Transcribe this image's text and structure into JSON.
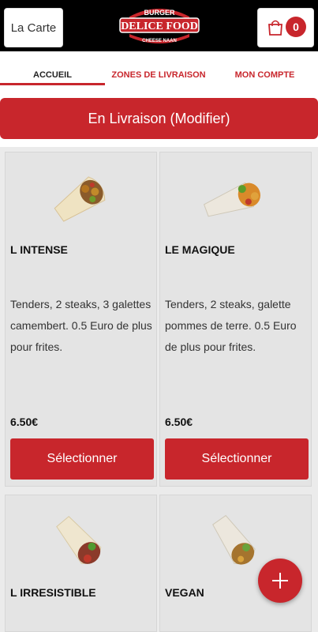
{
  "header": {
    "menu_label": "La Carte",
    "logo": {
      "top_text": "BURGER",
      "brand": "DELICE FOOD",
      "bottom_text": "CHEESE NAAN"
    },
    "cart_count": "0"
  },
  "tabs": [
    {
      "label": "ACCUEIL"
    },
    {
      "label": "ZONES DE LIVRAISON"
    },
    {
      "label": "MON COMPTE"
    }
  ],
  "delivery_mode_label": "En Livraison (Modifier)",
  "products": [
    {
      "name": "L INTENSE",
      "description": "Tenders, 2 steaks, 3 galettes camembert. 0.5 Euro de plus pour frites.",
      "price": "6.50€",
      "button_label": "Sélectionner",
      "image_icon": "wrap-image-icon"
    },
    {
      "name": "LE MAGIQUE",
      "description": "Tenders, 2 steaks, galette pommes de terre. 0.5 Euro de plus pour frites.",
      "price": "6.50€",
      "button_label": "Sélectionner",
      "image_icon": "wrap-image-icon"
    },
    {
      "name": "L IRRESISTIBLE",
      "image_icon": "wrap-image-icon"
    },
    {
      "name": "VEGAN",
      "image_icon": "wrap-image-icon"
    }
  ],
  "colors": {
    "accent": "#c8262c",
    "header_bg": "#000000",
    "card_bg": "#e4e4e4"
  },
  "fab_icon": "plus-icon"
}
